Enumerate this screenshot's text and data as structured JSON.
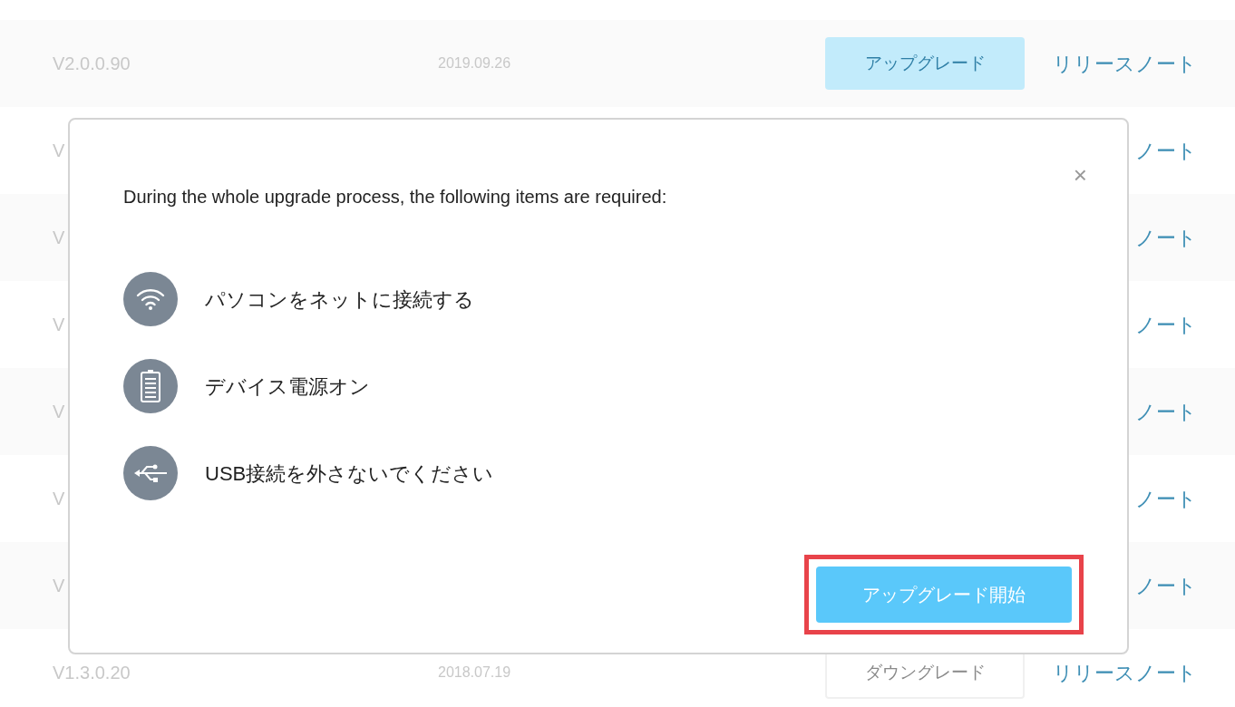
{
  "versions": [
    {
      "version": "V2.0.0.90",
      "date": "2019.09.26",
      "action": {
        "kind": "upgrade",
        "label": "アップグレード"
      },
      "notes": "リリースノート"
    },
    {
      "version": "V",
      "notes": "ノート"
    },
    {
      "version": "V",
      "notes": "ノート"
    },
    {
      "version": "V",
      "notes": "ノート"
    },
    {
      "version": "V",
      "notes": "ノート"
    },
    {
      "version": "V",
      "notes": "ノート"
    },
    {
      "version": "V",
      "notes": "ノート"
    },
    {
      "version": "V1.3.0.20",
      "date": "2018.07.19",
      "action": {
        "kind": "downgrade",
        "label": "ダウングレード"
      },
      "notes": "リリースノート"
    }
  ],
  "dialog": {
    "close": "×",
    "heading": "During the whole upgrade process, the following items are required:",
    "requirements": [
      {
        "kind": "wifi",
        "text": "パソコンをネットに接続する"
      },
      {
        "kind": "battery",
        "text": "デバイス電源オン"
      },
      {
        "kind": "usb",
        "text": "USB接続を外さないでください"
      }
    ],
    "start_button": {
      "label": "アップグレード開始",
      "highlighted": true
    }
  }
}
